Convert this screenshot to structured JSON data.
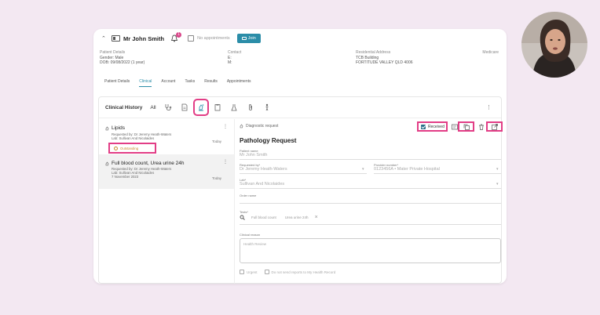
{
  "header": {
    "patient_name": "Mr John Smith",
    "notification_count": "1",
    "appointments_text": "No appointments",
    "join_label": "Join"
  },
  "patient_details": {
    "heading": "Patient Details",
    "gender": "Gender: Male",
    "dob": "DOB: 09/08/2022 (1 year)"
  },
  "contact": {
    "heading": "Contact",
    "e": "E:",
    "m": "M:"
  },
  "address": {
    "heading": "Residential Address",
    "line1": "TCB Building",
    "line2": "FORTITUDE VALLEY QLD 4006"
  },
  "medicare": "Medicare",
  "tabs": [
    "Patient Details",
    "Clinical",
    "Account",
    "Tasks",
    "Results",
    "Appointments"
  ],
  "history": {
    "title": "Clinical History",
    "all": "All"
  },
  "items": [
    {
      "title": "Lipids",
      "requested_by": "Requested by: Dr Jeremy Heath-Waters",
      "lab": "Lab: Sullivan And Nicolaides",
      "date": "Today",
      "status": "Outstanding"
    },
    {
      "title": "Full blood count, Urea urine 24h",
      "requested_by": "Requested by: Dr Jeremy Heath-Waters",
      "lab": "Lab: Sullivan And Nicolaides",
      "sub_date": "7 November 2023",
      "date": "Today"
    }
  ],
  "request": {
    "type_label": "Diagnostic request",
    "received_label": "Received",
    "title": "Pathology Request",
    "patient_name_label": "Patient name",
    "patient_name": "Mr John Smith",
    "requested_by_label": "Requested by*",
    "requested_by": "Dr Jeremy Heath-Waters",
    "provider_label": "Provider number*",
    "provider": "0123456A • Mater Private Hospital",
    "lab_label": "Lab*",
    "lab": "Sullivan And Nicolaides",
    "order_name_label": "Order name",
    "tests_label": "Tests*",
    "test1": "Full blood count",
    "test2": "Urea urine 24h",
    "clinical_label": "Clinical reason",
    "clinical_placeholder": "Health Review",
    "urgent_label": "Urgent",
    "no_send_label": "Do not send reports to My Health Record"
  },
  "colors": {
    "accent": "#2b8da8",
    "highlight": "#e23d86",
    "background": "#f3e8f2"
  }
}
